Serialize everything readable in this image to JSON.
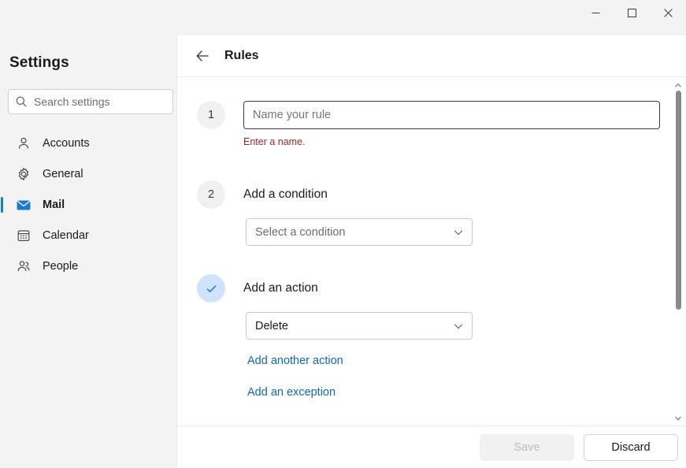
{
  "window": {
    "controls": [
      {
        "name": "minimize",
        "glyph": "minimize-icon"
      },
      {
        "name": "maximize",
        "glyph": "maximize-icon"
      },
      {
        "name": "close",
        "glyph": "close-icon"
      }
    ]
  },
  "sidebar": {
    "title": "Settings",
    "search": {
      "placeholder": "Search settings",
      "value": "",
      "icon": "search-icon"
    },
    "items": [
      {
        "label": "Accounts",
        "icon": "person-icon",
        "selected": false
      },
      {
        "label": "General",
        "icon": "gear-icon",
        "selected": false
      },
      {
        "label": "Mail",
        "icon": "envelope-icon",
        "selected": true
      },
      {
        "label": "Calendar",
        "icon": "calendar-icon",
        "selected": false
      },
      {
        "label": "People",
        "icon": "people-icon",
        "selected": false
      }
    ]
  },
  "content": {
    "back_icon": "back-arrow-icon",
    "title": "Rules",
    "steps": [
      {
        "badge": "1",
        "badge_state": "number",
        "input_placeholder": "Name your rule",
        "input_value": "",
        "error": "Enter a name."
      },
      {
        "badge": "2",
        "badge_state": "number",
        "label": "Add a condition",
        "dropdown_value": "Select a condition",
        "dropdown_filled": false
      },
      {
        "badge": "✓",
        "badge_state": "done",
        "label": "Add an action",
        "dropdown_value": "Delete",
        "dropdown_filled": true
      }
    ],
    "links": [
      {
        "label": "Add another action"
      },
      {
        "label": "Add an exception"
      }
    ]
  },
  "footer": {
    "save_label": "Save",
    "save_disabled": true,
    "discard_label": "Discard"
  },
  "colors": {
    "accent": "#1a7ad1",
    "link": "#1267b4",
    "error": "#a4262c",
    "badge_done_bg": "#cfe4fa",
    "badge_bg": "#f0f0f0",
    "window_bg": "#f3f3f3"
  }
}
